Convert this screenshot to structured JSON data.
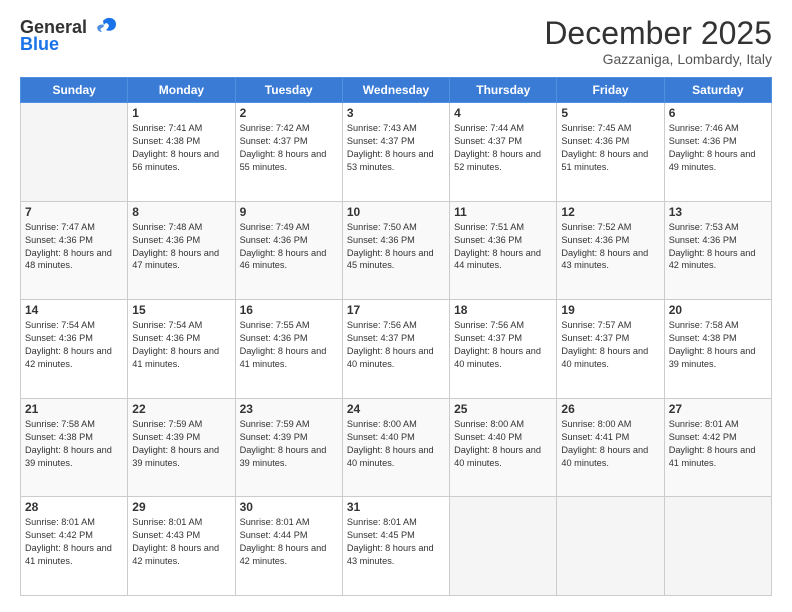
{
  "header": {
    "logo_general": "General",
    "logo_blue": "Blue",
    "month_title": "December 2025",
    "location": "Gazzaniga, Lombardy, Italy"
  },
  "weekdays": [
    "Sunday",
    "Monday",
    "Tuesday",
    "Wednesday",
    "Thursday",
    "Friday",
    "Saturday"
  ],
  "weeks": [
    [
      {
        "day": "",
        "sunrise": "",
        "sunset": "",
        "daylight": ""
      },
      {
        "day": "1",
        "sunrise": "7:41 AM",
        "sunset": "4:38 PM",
        "daylight": "8 hours and 56 minutes."
      },
      {
        "day": "2",
        "sunrise": "7:42 AM",
        "sunset": "4:37 PM",
        "daylight": "8 hours and 55 minutes."
      },
      {
        "day": "3",
        "sunrise": "7:43 AM",
        "sunset": "4:37 PM",
        "daylight": "8 hours and 53 minutes."
      },
      {
        "day": "4",
        "sunrise": "7:44 AM",
        "sunset": "4:37 PM",
        "daylight": "8 hours and 52 minutes."
      },
      {
        "day": "5",
        "sunrise": "7:45 AM",
        "sunset": "4:36 PM",
        "daylight": "8 hours and 51 minutes."
      },
      {
        "day": "6",
        "sunrise": "7:46 AM",
        "sunset": "4:36 PM",
        "daylight": "8 hours and 49 minutes."
      }
    ],
    [
      {
        "day": "7",
        "sunrise": "7:47 AM",
        "sunset": "4:36 PM",
        "daylight": "8 hours and 48 minutes."
      },
      {
        "day": "8",
        "sunrise": "7:48 AM",
        "sunset": "4:36 PM",
        "daylight": "8 hours and 47 minutes."
      },
      {
        "day": "9",
        "sunrise": "7:49 AM",
        "sunset": "4:36 PM",
        "daylight": "8 hours and 46 minutes."
      },
      {
        "day": "10",
        "sunrise": "7:50 AM",
        "sunset": "4:36 PM",
        "daylight": "8 hours and 45 minutes."
      },
      {
        "day": "11",
        "sunrise": "7:51 AM",
        "sunset": "4:36 PM",
        "daylight": "8 hours and 44 minutes."
      },
      {
        "day": "12",
        "sunrise": "7:52 AM",
        "sunset": "4:36 PM",
        "daylight": "8 hours and 43 minutes."
      },
      {
        "day": "13",
        "sunrise": "7:53 AM",
        "sunset": "4:36 PM",
        "daylight": "8 hours and 42 minutes."
      }
    ],
    [
      {
        "day": "14",
        "sunrise": "7:54 AM",
        "sunset": "4:36 PM",
        "daylight": "8 hours and 42 minutes."
      },
      {
        "day": "15",
        "sunrise": "7:54 AM",
        "sunset": "4:36 PM",
        "daylight": "8 hours and 41 minutes."
      },
      {
        "day": "16",
        "sunrise": "7:55 AM",
        "sunset": "4:36 PM",
        "daylight": "8 hours and 41 minutes."
      },
      {
        "day": "17",
        "sunrise": "7:56 AM",
        "sunset": "4:37 PM",
        "daylight": "8 hours and 40 minutes."
      },
      {
        "day": "18",
        "sunrise": "7:56 AM",
        "sunset": "4:37 PM",
        "daylight": "8 hours and 40 minutes."
      },
      {
        "day": "19",
        "sunrise": "7:57 AM",
        "sunset": "4:37 PM",
        "daylight": "8 hours and 40 minutes."
      },
      {
        "day": "20",
        "sunrise": "7:58 AM",
        "sunset": "4:38 PM",
        "daylight": "8 hours and 39 minutes."
      }
    ],
    [
      {
        "day": "21",
        "sunrise": "7:58 AM",
        "sunset": "4:38 PM",
        "daylight": "8 hours and 39 minutes."
      },
      {
        "day": "22",
        "sunrise": "7:59 AM",
        "sunset": "4:39 PM",
        "daylight": "8 hours and 39 minutes."
      },
      {
        "day": "23",
        "sunrise": "7:59 AM",
        "sunset": "4:39 PM",
        "daylight": "8 hours and 39 minutes."
      },
      {
        "day": "24",
        "sunrise": "8:00 AM",
        "sunset": "4:40 PM",
        "daylight": "8 hours and 40 minutes."
      },
      {
        "day": "25",
        "sunrise": "8:00 AM",
        "sunset": "4:40 PM",
        "daylight": "8 hours and 40 minutes."
      },
      {
        "day": "26",
        "sunrise": "8:00 AM",
        "sunset": "4:41 PM",
        "daylight": "8 hours and 40 minutes."
      },
      {
        "day": "27",
        "sunrise": "8:01 AM",
        "sunset": "4:42 PM",
        "daylight": "8 hours and 41 minutes."
      }
    ],
    [
      {
        "day": "28",
        "sunrise": "8:01 AM",
        "sunset": "4:42 PM",
        "daylight": "8 hours and 41 minutes."
      },
      {
        "day": "29",
        "sunrise": "8:01 AM",
        "sunset": "4:43 PM",
        "daylight": "8 hours and 42 minutes."
      },
      {
        "day": "30",
        "sunrise": "8:01 AM",
        "sunset": "4:44 PM",
        "daylight": "8 hours and 42 minutes."
      },
      {
        "day": "31",
        "sunrise": "8:01 AM",
        "sunset": "4:45 PM",
        "daylight": "8 hours and 43 minutes."
      },
      {
        "day": "",
        "sunrise": "",
        "sunset": "",
        "daylight": ""
      },
      {
        "day": "",
        "sunrise": "",
        "sunset": "",
        "daylight": ""
      },
      {
        "day": "",
        "sunrise": "",
        "sunset": "",
        "daylight": ""
      }
    ]
  ],
  "labels": {
    "sunrise": "Sunrise:",
    "sunset": "Sunset:",
    "daylight": "Daylight:"
  }
}
